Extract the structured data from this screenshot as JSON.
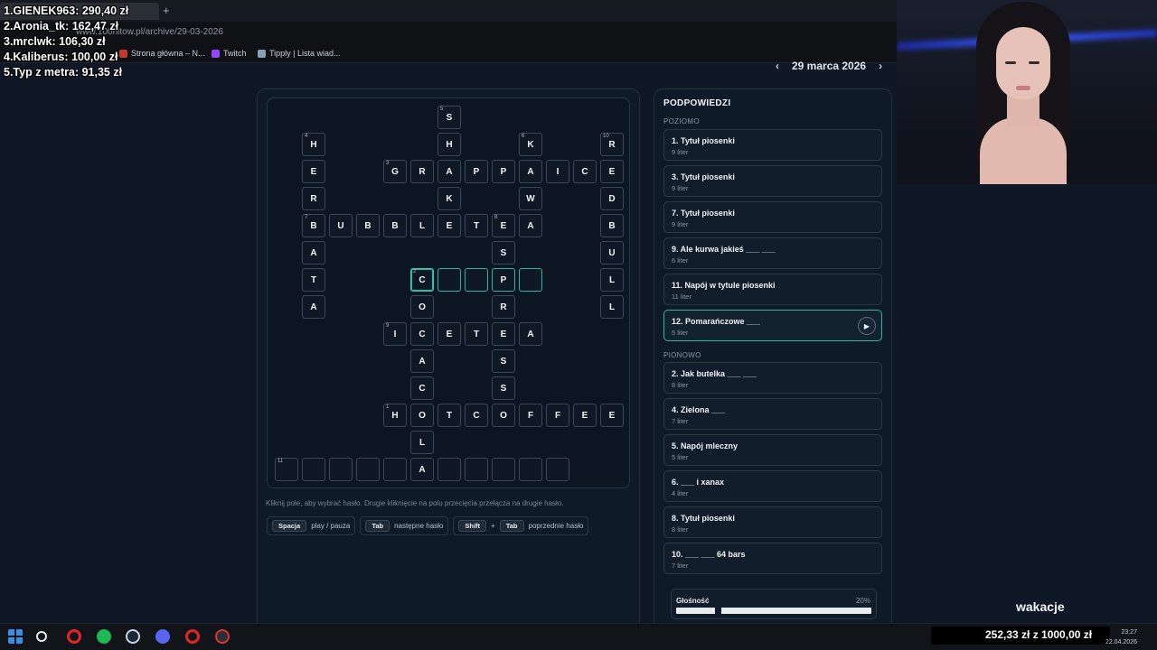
{
  "browser": {
    "url": "www.100hitow.pl/archive/29-03-2026",
    "bookmarks": [
      "Strona główna – N...",
      "Twitch",
      "Tipply | Lista wiad..."
    ]
  },
  "leaderboard": [
    "1.GIENEK963: 290,40 zł",
    "2.Aronia_tk: 162,47 zł",
    "3.mrclwk: 106,30 zł",
    "4.Kaliberus: 100,00 zł",
    "5.Typ z metra: 91,35 zł"
  ],
  "header": {
    "date": "29 marca 2026",
    "prev_icon": "chevron-left",
    "next_icon": "chevron-right"
  },
  "board_help": {
    "hint_text": "Kliknij pole, aby wybrać hasło. Drugie kliknięcie na polu przecięcia przełącza na drugie hasło.",
    "keys": [
      {
        "keys": [
          "Spacja"
        ],
        "label": "play / pauza"
      },
      {
        "keys": [
          "Tab"
        ],
        "label": "następne hasło"
      },
      {
        "keys": [
          "Shift",
          "Tab"
        ],
        "joiner": "+",
        "label": "poprzednie hasło"
      }
    ]
  },
  "crossword": {
    "origin_note": "grid columns 0..12, rows 0..13",
    "cells": [
      {
        "r": 0,
        "c": 6,
        "v": "S",
        "n": "5"
      },
      {
        "r": 1,
        "c": 1,
        "v": "H",
        "n": "4"
      },
      {
        "r": 1,
        "c": 6,
        "v": "H"
      },
      {
        "r": 1,
        "c": 9,
        "v": "K",
        "n": "6"
      },
      {
        "r": 1,
        "c": 12,
        "v": "R",
        "n": "10"
      },
      {
        "r": 2,
        "c": 1,
        "v": "E"
      },
      {
        "r": 2,
        "c": 4,
        "v": "G",
        "n": "3"
      },
      {
        "r": 2,
        "c": 5,
        "v": "R"
      },
      {
        "r": 2,
        "c": 6,
        "v": "A"
      },
      {
        "r": 2,
        "c": 7,
        "v": "P"
      },
      {
        "r": 2,
        "c": 8,
        "v": "P"
      },
      {
        "r": 2,
        "c": 9,
        "v": "A"
      },
      {
        "r": 2,
        "c": 10,
        "v": "I"
      },
      {
        "r": 2,
        "c": 11,
        "v": "C"
      },
      {
        "r": 2,
        "c": 12,
        "v": "E"
      },
      {
        "r": 3,
        "c": 1,
        "v": "R"
      },
      {
        "r": 3,
        "c": 6,
        "v": "K"
      },
      {
        "r": 3,
        "c": 9,
        "v": "W"
      },
      {
        "r": 3,
        "c": 12,
        "v": "D"
      },
      {
        "r": 4,
        "c": 1,
        "v": "B",
        "n": "7"
      },
      {
        "r": 4,
        "c": 2,
        "v": "U"
      },
      {
        "r": 4,
        "c": 3,
        "v": "B"
      },
      {
        "r": 4,
        "c": 4,
        "v": "B"
      },
      {
        "r": 4,
        "c": 5,
        "v": "L"
      },
      {
        "r": 4,
        "c": 6,
        "v": "E"
      },
      {
        "r": 4,
        "c": 7,
        "v": "T"
      },
      {
        "r": 4,
        "c": 8,
        "v": "E",
        "n": "8"
      },
      {
        "r": 4,
        "c": 9,
        "v": "A"
      },
      {
        "r": 4,
        "c": 12,
        "v": "B"
      },
      {
        "r": 5,
        "c": 1,
        "v": "A"
      },
      {
        "r": 5,
        "c": 8,
        "v": "S"
      },
      {
        "r": 5,
        "c": 12,
        "v": "U"
      },
      {
        "r": 6,
        "c": 1,
        "v": "T"
      },
      {
        "r": 6,
        "c": 5,
        "v": "C",
        "n": "2",
        "s": "sel"
      },
      {
        "r": 6,
        "c": 6,
        "v": "",
        "s": "hl"
      },
      {
        "r": 6,
        "c": 7,
        "v": "",
        "s": "hl"
      },
      {
        "r": 6,
        "c": 8,
        "v": "P",
        "s": "hl"
      },
      {
        "r": 6,
        "c": 9,
        "v": "",
        "s": "hl"
      },
      {
        "r": 6,
        "c": 12,
        "v": "L"
      },
      {
        "r": 7,
        "c": 1,
        "v": "A"
      },
      {
        "r": 7,
        "c": 5,
        "v": "O"
      },
      {
        "r": 7,
        "c": 8,
        "v": "R"
      },
      {
        "r": 7,
        "c": 12,
        "v": "L"
      },
      {
        "r": 8,
        "c": 4,
        "v": "I",
        "n": "9"
      },
      {
        "r": 8,
        "c": 5,
        "v": "C"
      },
      {
        "r": 8,
        "c": 6,
        "v": "E"
      },
      {
        "r": 8,
        "c": 7,
        "v": "T"
      },
      {
        "r": 8,
        "c": 8,
        "v": "E"
      },
      {
        "r": 8,
        "c": 9,
        "v": "A"
      },
      {
        "r": 9,
        "c": 5,
        "v": "A"
      },
      {
        "r": 9,
        "c": 8,
        "v": "S"
      },
      {
        "r": 10,
        "c": 5,
        "v": "C"
      },
      {
        "r": 10,
        "c": 8,
        "v": "S"
      },
      {
        "r": 11,
        "c": 4,
        "v": "H",
        "n": "1"
      },
      {
        "r": 11,
        "c": 5,
        "v": "O"
      },
      {
        "r": 11,
        "c": 6,
        "v": "T"
      },
      {
        "r": 11,
        "c": 7,
        "v": "C"
      },
      {
        "r": 11,
        "c": 8,
        "v": "O"
      },
      {
        "r": 11,
        "c": 9,
        "v": "F"
      },
      {
        "r": 11,
        "c": 10,
        "v": "F"
      },
      {
        "r": 11,
        "c": 11,
        "v": "E"
      },
      {
        "r": 11,
        "c": 12,
        "v": "E"
      },
      {
        "r": 12,
        "c": 5,
        "v": "L"
      },
      {
        "r": 13,
        "c": 0,
        "v": "",
        "n": "11"
      },
      {
        "r": 13,
        "c": 1,
        "v": ""
      },
      {
        "r": 13,
        "c": 2,
        "v": ""
      },
      {
        "r": 13,
        "c": 3,
        "v": ""
      },
      {
        "r": 13,
        "c": 4,
        "v": ""
      },
      {
        "r": 13,
        "c": 5,
        "v": "A"
      },
      {
        "r": 13,
        "c": 6,
        "v": ""
      },
      {
        "r": 13,
        "c": 7,
        "v": ""
      },
      {
        "r": 13,
        "c": 8,
        "v": ""
      },
      {
        "r": 13,
        "c": 9,
        "v": ""
      },
      {
        "r": 13,
        "c": 10,
        "v": ""
      }
    ]
  },
  "hints": {
    "title": "PODPOWIEDZI",
    "across_label": "POZIOMO",
    "down_label": "PIONOWO",
    "across": [
      {
        "title": "1. Tytuł piosenki",
        "len": "9 liter"
      },
      {
        "title": "3. Tytuł piosenki",
        "len": "9 liter"
      },
      {
        "title": "7. Tytuł piosenki",
        "len": "9 liter"
      },
      {
        "title": "9. Ale kurwa jakieś ___ ___",
        "len": "6 liter"
      },
      {
        "title": "11. Napój w tytule piosenki",
        "len": "11 liter"
      },
      {
        "title": "12. Pomarańczowe ___",
        "len": "5 liter",
        "active": true
      }
    ],
    "down": [
      {
        "title": "2. Jak butelka ___ ___",
        "len": "8 liter"
      },
      {
        "title": "4. Zielona ___",
        "len": "7 liter"
      },
      {
        "title": "5. Napój mleczny",
        "len": "5 liter"
      },
      {
        "title": "6. ___ i xanax",
        "len": "4 liter"
      },
      {
        "title": "8. Tytuł piosenki",
        "len": "8 liter"
      },
      {
        "title": "10. ___ ___ 64 bars",
        "len": "7 liter"
      }
    ]
  },
  "volume": {
    "label": "Głośność",
    "value": "20%"
  },
  "overlay": {
    "caption": "wakacje",
    "goal": "252,33 zł z 1000,00 zł"
  },
  "clock": {
    "time": "23:27",
    "date": "22.04.2026"
  },
  "colors": {
    "accent": "#2fb3a3",
    "bg": "#0e1826"
  }
}
